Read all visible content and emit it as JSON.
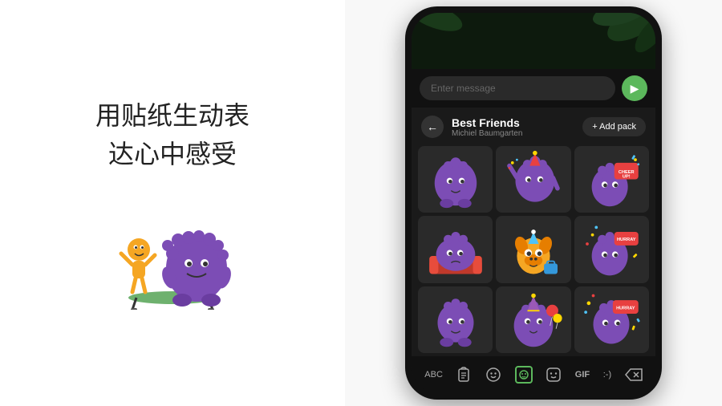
{
  "left": {
    "main_text_line1": "用贴纸生动表",
    "main_text_line2": "达心中感受"
  },
  "phone": {
    "input_placeholder": "Enter message",
    "back_label": "←",
    "pack_name": "Best Friends",
    "pack_author": "Michiel Baumgarten",
    "add_pack_label": "+ Add pack",
    "send_icon": "▶",
    "toolbar": {
      "abc": "ABC",
      "clipboard": "⊡",
      "emoji": "☺",
      "sticker": "sticker",
      "face": "☻",
      "gif": "GIF",
      "colon": ":-)",
      "delete": "⌫"
    }
  }
}
